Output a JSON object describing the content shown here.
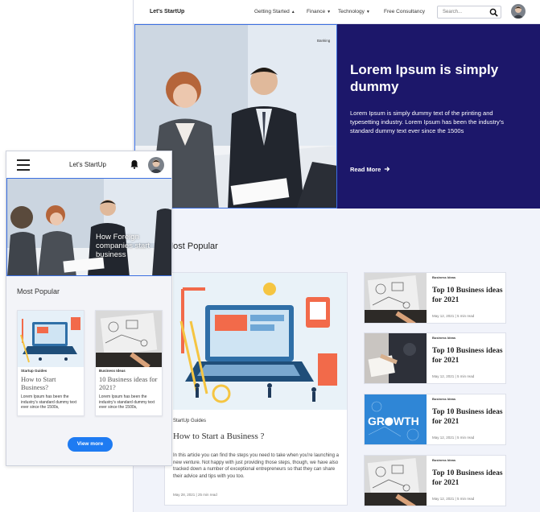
{
  "desktop": {
    "nav": {
      "logo": "Let's StartUp",
      "menu": [
        "Getting Started",
        "Finance",
        "Technology"
      ],
      "free_consultancy": "Free Consultancy",
      "search_placeholder": "Search..."
    },
    "hero": {
      "tag": "Banking",
      "title": "Lorem Ipsum is simply dummy",
      "body": "Lorem Ipsum is simply dummy text of the printing and typesetting industry. Lorem Ipsum has been the industry's standard dummy text ever since the 1500s",
      "read_more": "Read More"
    },
    "popular": {
      "title": "Most Popular",
      "featured": {
        "category": "StartUp Guides",
        "title": "How to Start a Business ?",
        "body": "In this article you can find the steps you need to take when you're launching a new venture. Not happy with just providing those steps, though, we have also tracked down a number of exceptional entrepreneurs so that they can share their advice and tips with you too.",
        "meta": "May 28, 2021 | 25 min read"
      },
      "side": [
        {
          "category": "Business Ideas",
          "title": "Top 10 Business ideas for 2021",
          "meta": "May 12, 2021 | 5 min read"
        },
        {
          "category": "Business Ideas",
          "title": "Top 10 Business ideas for 2021",
          "meta": "May 12, 2021 | 5 min read"
        },
        {
          "category": "Business Ideas",
          "title": "Top 10 Business ideas for 2021",
          "meta": "May 12, 2021 | 5 min read"
        },
        {
          "category": "Business Ideas",
          "title": "Top 10 Business ideas for 2021",
          "meta": "May 12, 2021 | 5 min read"
        }
      ]
    }
  },
  "mobile": {
    "title": "Let's StartUp",
    "hero_caption": "How Foreign companies start business",
    "popular_title": "Most Popular",
    "cards": [
      {
        "category": "Startup Guides",
        "title": "How to Start Business?",
        "body": "Lorem Ipsum has been the industry's standard dummy text ever since the 1500s,"
      },
      {
        "category": "Business Ideas",
        "title": "10 Business ideas for 2021?",
        "body": "Lorem Ipsum has been the industry's standard dummy text ever since the 1500s,"
      }
    ],
    "view_more": "View more"
  },
  "colors": {
    "hero_panel": "#1c176a",
    "button_blue": "#1e7bf2",
    "selection_border": "#3b6fe0"
  }
}
